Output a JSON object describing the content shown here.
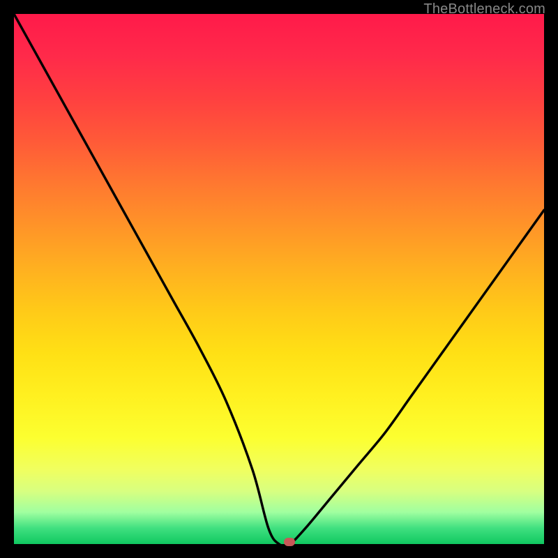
{
  "watermark": "TheBottleneck.com",
  "chart_data": {
    "type": "line",
    "title": "",
    "xlabel": "",
    "ylabel": "",
    "xlim": [
      0,
      100
    ],
    "ylim": [
      0,
      100
    ],
    "grid": false,
    "legend": false,
    "x": [
      0,
      5,
      10,
      15,
      20,
      25,
      30,
      35,
      40,
      45,
      48,
      50,
      52,
      55,
      60,
      65,
      70,
      75,
      80,
      85,
      90,
      95,
      100
    ],
    "values": [
      100,
      91,
      82,
      73,
      64,
      55,
      46,
      37,
      27,
      14,
      3,
      0,
      0,
      3,
      9,
      15,
      21,
      28,
      35,
      42,
      49,
      56,
      63
    ],
    "marker": {
      "x": 52,
      "y": 0
    },
    "colors": {
      "gradient_top": "#ff1a4a",
      "gradient_bottom": "#10c860",
      "curve": "#000000",
      "marker": "#c85858",
      "frame": "#000000"
    }
  }
}
